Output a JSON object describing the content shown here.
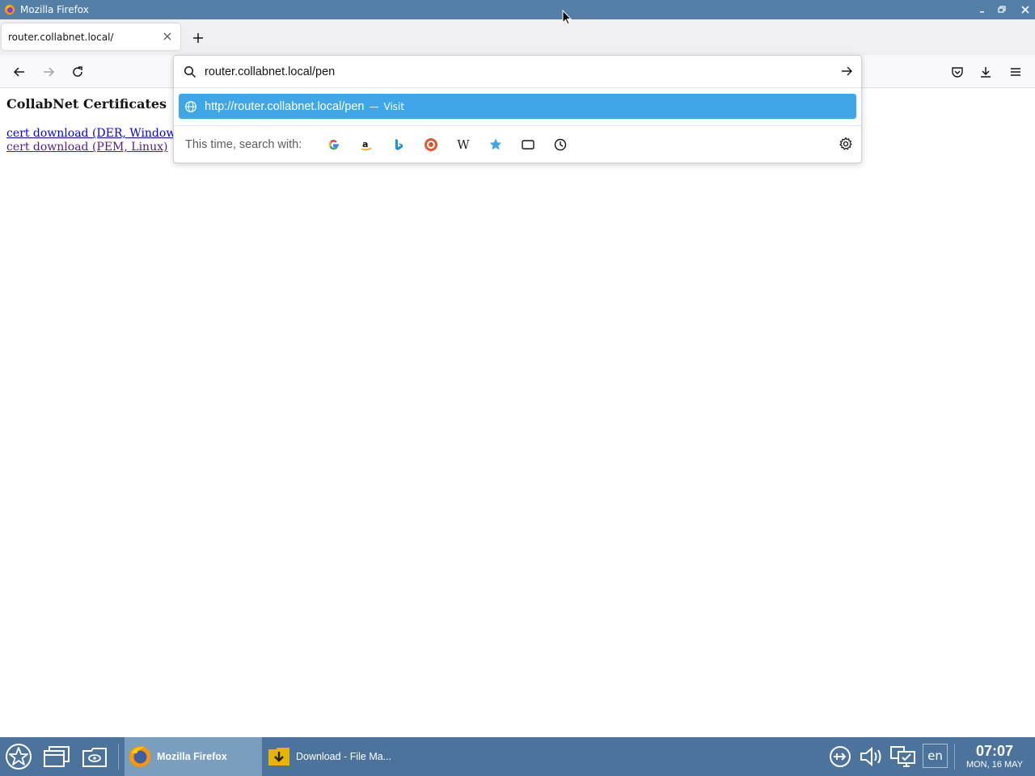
{
  "window": {
    "title": "Mozilla Firefox"
  },
  "tabs": [
    {
      "title": "router.collabnet.local/"
    }
  ],
  "urlbar": {
    "value": "router.collabnet.local/pen",
    "suggestion_url": "http://router.collabnet.local/pen",
    "suggestion_separator": "—",
    "suggestion_action": "Visit",
    "search_with_label": "This time, search with:",
    "engines": [
      "google-icon",
      "amazon-icon",
      "bing-icon",
      "duckduckgo-icon",
      "wikipedia-icon",
      "bookmarks-icon",
      "tabs-icon",
      "history-icon"
    ]
  },
  "page": {
    "heading": "CollabNet Certificates",
    "links": [
      {
        "text": "cert download (DER, Windows)"
      },
      {
        "text": "cert download (PEM, Linux)"
      }
    ]
  },
  "taskbar": {
    "tasks": [
      {
        "label": "Mozilla Firefox",
        "active": true
      },
      {
        "label": "Download - File Ma..."
      }
    ],
    "language": "en",
    "time": "07:07",
    "date": "MON, 16 MAY"
  },
  "colors": {
    "titlebar": "#5480a8",
    "taskbar": "#4c739b",
    "highlight": "#3fa7e8",
    "link": "#0000ee",
    "visited_link": "#551a8b"
  }
}
